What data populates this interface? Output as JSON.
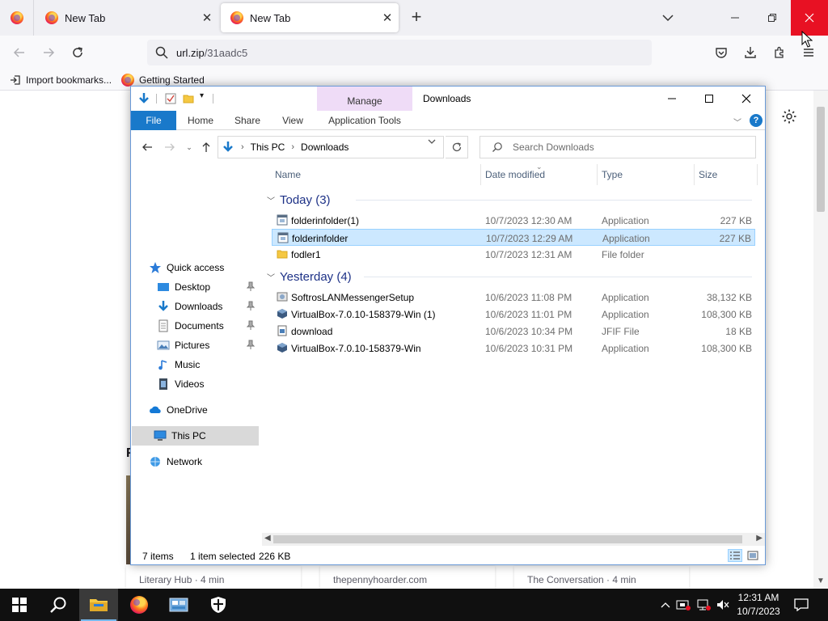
{
  "browser": {
    "tabs": [
      {
        "title": "New Tab",
        "active": false
      },
      {
        "title": "New Tab",
        "active": true
      }
    ],
    "new_tab_symbol": "+",
    "url": {
      "host": "url.zip",
      "path": "/31aadc5"
    },
    "bookmarks": [
      {
        "label": "Import bookmarks...",
        "icon": "import-icon"
      },
      {
        "label": "Getting Started",
        "icon": "firefox-icon"
      }
    ],
    "window_controls": {
      "close_color": "#e81123"
    }
  },
  "page": {
    "heading_fragment": "F",
    "stories": [
      {
        "source": "Literary Hub · 4 min"
      },
      {
        "source": "thepennyhoarder.com"
      },
      {
        "source": "The Conversation · 4 min"
      }
    ]
  },
  "explorer": {
    "title": "Downloads",
    "manage_label": "Manage",
    "ribbon_tabs": [
      "File",
      "Home",
      "Share",
      "View",
      "Application Tools"
    ],
    "help_label": "?",
    "address": [
      "This PC",
      "Downloads"
    ],
    "search_placeholder": "Search Downloads",
    "nav": {
      "quick_access": "Quick access",
      "pinned": [
        {
          "label": "Desktop",
          "pinned": true
        },
        {
          "label": "Downloads",
          "pinned": true
        },
        {
          "label": "Documents",
          "pinned": true
        },
        {
          "label": "Pictures",
          "pinned": true
        },
        {
          "label": "Music",
          "pinned": false
        },
        {
          "label": "Videos",
          "pinned": false
        }
      ],
      "onedrive": "OneDrive",
      "this_pc": "This PC",
      "network": "Network"
    },
    "columns": [
      "Name",
      "Date modified",
      "Type",
      "Size"
    ],
    "groups": [
      {
        "label": "Today (3)",
        "files": [
          {
            "name": "folderinfolder(1)",
            "date": "10/7/2023 12:30 AM",
            "type": "Application",
            "size": "227 KB",
            "icon": "app-window-icon",
            "selected": false
          },
          {
            "name": "folderinfolder",
            "date": "10/7/2023 12:29 AM",
            "type": "Application",
            "size": "227 KB",
            "icon": "app-window-icon",
            "selected": true
          },
          {
            "name": "fodler1",
            "date": "10/7/2023 12:31 AM",
            "type": "File folder",
            "size": "",
            "icon": "folder-icon",
            "selected": false
          }
        ]
      },
      {
        "label": "Yesterday (4)",
        "files": [
          {
            "name": "SoftrosLANMessengerSetup",
            "date": "10/6/2023 11:08 PM",
            "type": "Application",
            "size": "38,132 KB",
            "icon": "installer-icon",
            "selected": false
          },
          {
            "name": "VirtualBox-7.0.10-158379-Win (1)",
            "date": "10/6/2023 11:01 PM",
            "type": "Application",
            "size": "108,300 KB",
            "icon": "virtualbox-icon",
            "selected": false
          },
          {
            "name": "download",
            "date": "10/6/2023 10:34 PM",
            "type": "JFIF File",
            "size": "18 KB",
            "icon": "image-file-icon",
            "selected": false
          },
          {
            "name": "VirtualBox-7.0.10-158379-Win",
            "date": "10/6/2023 10:31 PM",
            "type": "Application",
            "size": "108,300 KB",
            "icon": "virtualbox-icon",
            "selected": false
          }
        ]
      }
    ],
    "status": {
      "items": "7 items",
      "selected": "1 item selected",
      "size": "226 KB"
    },
    "colors": {
      "file_tab": "#1979ca",
      "manage_tab": "#efdcf7",
      "selection": "#cce8ff",
      "group_header": "#1e3287"
    }
  },
  "taskbar": {
    "clock_time": "12:31 AM",
    "clock_date": "10/7/2023",
    "apps": [
      "windows-start-icon",
      "search-icon",
      "file-explorer-icon",
      "firefox-icon",
      "control-panel-icon",
      "security-shield-icon"
    ]
  }
}
